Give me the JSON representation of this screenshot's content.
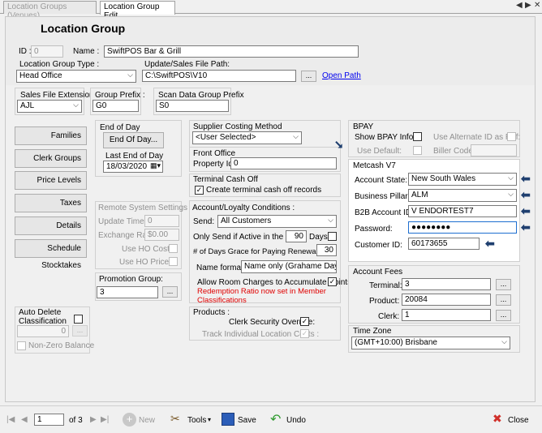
{
  "tabs": [
    {
      "label": "Location Groups (Venues)"
    },
    {
      "label": "Location Group Edit"
    }
  ],
  "window_controls": {
    "left": "◀",
    "right": "▶",
    "close": "✕"
  },
  "title": "Location Group",
  "id": {
    "label": "ID :",
    "value": "0"
  },
  "name": {
    "label": "Name :",
    "value": "SwiftPOS Bar & Grill"
  },
  "group_type": {
    "label": "Location Group Type :",
    "value": "Head Office"
  },
  "update_path": {
    "label": "Update/Sales File Path:",
    "value": "C:\\SwiftPOS\\V10",
    "browse": "...",
    "open_link": "Open Path"
  },
  "sales_ext": {
    "label": "Sales File Extension",
    "value": "AJL"
  },
  "group_prefix": {
    "label": "Group Prefix :",
    "value": "G0"
  },
  "scan_prefix": {
    "label": "Scan Data Group Prefix",
    "value": "S0"
  },
  "side_buttons": [
    "Families",
    "Clerk Groups",
    "Price Levels",
    "Taxes",
    "Details",
    "Schedule Stocktakes"
  ],
  "end_of_day": {
    "label": "End of Day",
    "button": "End Of Day...",
    "last_label": "Last End of Day",
    "last_value": "18/03/2020"
  },
  "remote": {
    "title": "Remote System Settings",
    "update_time_label": "Update Time :",
    "update_time": "0",
    "exchange_label": "Exchange Rate",
    "exchange": "$0.00",
    "ho_costs": "Use HO Costs :",
    "ho_prices": "Use HO Prices :"
  },
  "promotion": {
    "label": "Promotion Group:",
    "value": "3",
    "btn": "..."
  },
  "auto_delete": {
    "label": "Auto Delete Classification",
    "value": "0",
    "btn": "...",
    "nonzero": "Non-Zero Balance"
  },
  "supplier": {
    "label": "Supplier Costing Method",
    "value": "<User Selected>"
  },
  "front_office": {
    "label": "Front Office",
    "prop_label": "Property Id:",
    "prop_value": "0"
  },
  "terminal_cashoff": {
    "label": "Terminal Cash Off",
    "check": "Create terminal cash off records",
    "check_mark": "✓"
  },
  "loyalty": {
    "label": "Account/Loyalty Conditions :",
    "send_label": "Send:",
    "send_value": "All Customers",
    "active_label": "Only Send if Active in the Last:",
    "active_value": "90",
    "days": "Days",
    "grace_label": "# of Days Grace for Paying Renewal Fee:",
    "grace_value": "30",
    "nameformat_label": "Name format:",
    "nameformat_value": "Name only (Grahame Day)",
    "allow_label": "Allow Room Charges to Accumulate Points :",
    "note": "Redemption Ratio now set in Member Classifications"
  },
  "products": {
    "label": "Products :",
    "clerk_override": "Clerk Security Override:",
    "track_costs": "Track Individual Location Costs :"
  },
  "bpay": {
    "label": "BPAY",
    "show_info": "Show BPAY Info:",
    "alt_id": "Use Alternate ID as Ref:",
    "use_default": "Use Default:",
    "biller_code": "Biller Code:"
  },
  "metcash": {
    "label": "Metcash V7",
    "state_label": "Account State:",
    "state_value": "New South Wales",
    "pillar_label": "Business Pillar:",
    "pillar_value": "ALM",
    "b2b_label": "B2B Account ID:",
    "b2b_value": "V ENDORTEST7",
    "password_label": "Password:",
    "password_value": "●●●●●●●●",
    "customer_label": "Customer ID:",
    "customer_value": "60173655"
  },
  "account_fees": {
    "label": "Account Fees",
    "terminal_label": "Terminal:",
    "terminal_value": "3",
    "product_label": "Product:",
    "product_value": "20084",
    "clerk_label": "Clerk:",
    "clerk_value": "1",
    "btn": "..."
  },
  "timezone": {
    "label": "Time Zone",
    "value": "(GMT+10:00) Brisbane"
  },
  "toolbar": {
    "page": "1",
    "of": "of 3",
    "new": "New",
    "tools": "Tools",
    "save": "Save",
    "undo": "Undo",
    "close": "Close"
  },
  "colors": {
    "accent": "#1e6fd0",
    "arrow": "#1f3f6f",
    "note": "#e00000"
  }
}
